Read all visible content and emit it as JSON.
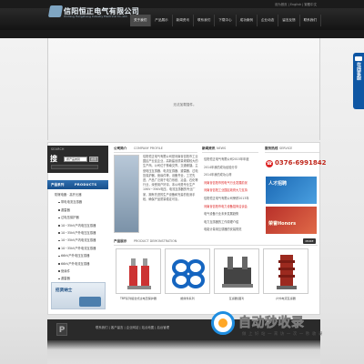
{
  "header": {
    "logo_cn": "信阳恒正电气有限公司",
    "logo_en": "XinYang Hengzheng Industry Electrical Co.,Ltd.",
    "top_links": "设为首页 | English | 繁體中文",
    "nav": [
      "关于我们",
      "产品展示",
      "新闻资讯",
      "联系我们",
      "下载中心",
      "成功案例",
      "企业动态",
      "留言反馈",
      "联系我们"
    ]
  },
  "banner": {
    "message": "无法加载插件。"
  },
  "side_tab": {
    "label": "在线客服"
  },
  "search": {
    "title": "SEARCH",
    "glyph": "搜",
    "select_value": "按产品类别",
    "go_label": "搜索"
  },
  "products_menu": {
    "title_cn": "产品系列",
    "title_en": "PRODUCTS",
    "items": [
      {
        "label": "防爆电器 · 高开元器",
        "sub": false
      },
      {
        "label": "带电电流互感器",
        "sub": true
      },
      {
        "label": "避雷器",
        "sub": true
      },
      {
        "label": "过电压保护器",
        "sub": true
      },
      {
        "label": "10~35kV户内电压互感器",
        "sub": true
      },
      {
        "label": "10~35kV户外电压互感器",
        "sub": true
      },
      {
        "label": "10~35kV户内电流互感器",
        "sub": true
      },
      {
        "label": "10~35kV户外电流互感器",
        "sub": true
      },
      {
        "label": "66kV户外电压互感器",
        "sub": true
      },
      {
        "label": "66kV户外电流互感器",
        "sub": true
      },
      {
        "label": "绝缘件",
        "sub": true
      },
      {
        "label": "避雷器",
        "sub": true
      }
    ],
    "job_label": "招贤纳士"
  },
  "about": {
    "title_cn": "公司简介",
    "title_en": "COMPANY PROFILE",
    "text": "信阳恒正电气有限公司是河南省信阳市工业园区产业区企业，高新建设质量规模较大的生产商。公司位于豫南交界，交通便捷。主营电压互感器、电流互感器、避雷器、过电压保护器、绝缘件等，设备齐全，工艺先进，产品广泛用于电力系统、冶金、石化等行业，深受用户好评。本公司是专业生产10KV~35KV电压、电流互感器的专业厂家，拥有先进的生产设备和完善的检测手段，确保产品质量稳定可靠。"
  },
  "news": {
    "title_cn": "新闻资讯",
    "title_en": "NEWS",
    "items": [
      {
        "text": "信阳恒正电气有限公司2015年年度",
        "red": false
      },
      {
        "text": "2014年我的成功经验分享",
        "red": false
      },
      {
        "text": "2014年我的成功心得",
        "red": false
      },
      {
        "text": "河南省信阳市的电气行业发展前景",
        "red": true
      },
      {
        "text": "河南省信阳工业园区政府大力支持",
        "red": true
      },
      {
        "text": "信阳恒正电气有限公司荣获2013年",
        "red": false
      },
      {
        "text": "河南省信阳市电力设备招商洽谈会",
        "red": true
      },
      {
        "text": "电气设备行业未来发展趋势",
        "red": false
      },
      {
        "text": "电力互感器的工作原理介绍",
        "red": false
      },
      {
        "text": "电能计量用互感器的安装规范",
        "red": false
      }
    ]
  },
  "service": {
    "title_cn": "服务热线",
    "title_en": "SERVICE",
    "phone": "0376-6991842",
    "phone_icon": "☎",
    "img1_label": "人才招聘",
    "img2_label": "荣誉Honors"
  },
  "products": {
    "title_cn": "产品展示",
    "title_en": "PRODUCT DEMONSTRATION",
    "more_label": "MORE",
    "items": [
      {
        "caption": "TBP系列组合式过电压保护器"
      },
      {
        "caption": "绝缘件系列"
      },
      {
        "caption": "互感器(图3)"
      },
      {
        "caption": "户外电流互感器"
      }
    ]
  },
  "footer": {
    "icon_letter": "P",
    "links": "联系我们 | 客户留言 | 企业网站 | 站点地图 | 后台管理"
  },
  "watermark": {
    "main": "自动秒收录",
    "sub": "做 上 好 站 一 来 访 一 次 一 秒 收 录"
  },
  "colors": {
    "header_bg": "#1b1b1b",
    "accent_blue": "#1a5c9c",
    "phone_red": "#c0271c",
    "footer_bg": "#2a2a2a"
  }
}
